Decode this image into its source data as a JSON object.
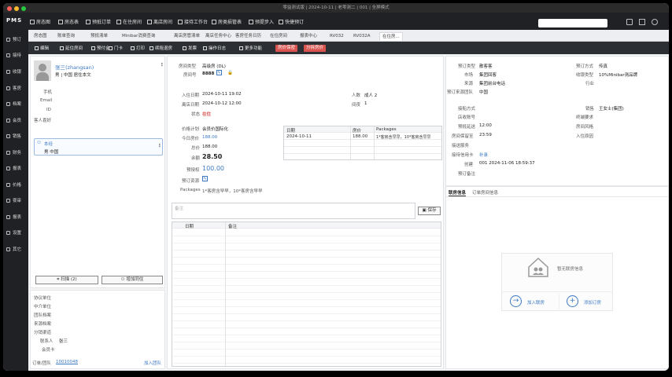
{
  "window": {
    "title": "零益测试版 | 2024-10-11 | 老零测二 | 001 | 全屏模式"
  },
  "logo": "PMS",
  "topnav": [
    "房态图",
    "房态表",
    "预抵订单",
    "在住房间",
    "离店房间",
    "接待工作台",
    "房类损管表",
    "预提步入",
    "快捷预订"
  ],
  "sidebar": [
    "预订",
    "接待",
    "收银",
    "客房",
    "档案",
    "会员",
    "销售",
    "财务",
    "报表",
    "价格",
    "夜审",
    "报表",
    "设置",
    "其它"
  ],
  "tabs": [
    "房态图",
    "账单查询",
    "预抵清单",
    "Minibar消费查询",
    "离店房管清单",
    "离店任务中心",
    "客房任务日历",
    "在住房间",
    "报表中心",
    "RV032",
    "RV032A",
    "在住房..."
  ],
  "toolbar": {
    "items": [
      "编辑",
      "延住房间",
      "预付金",
      "门卡",
      "打印",
      "续租退房",
      "发票",
      "操作日志",
      "更多功能"
    ],
    "red1": "房价保密",
    "red2": "分拆房价"
  },
  "guest": {
    "name": "张三(zhangsan)",
    "line": "男 | 中国 居住本文",
    "labels": [
      "手机",
      "Email",
      "ID",
      "客人喜好"
    ],
    "sub_name": "本经",
    "sub_line": "男 中国",
    "scan": "扫描 (2)",
    "add": "增加同住"
  },
  "left_bottom": {
    "labels": [
      "协议单位",
      "中介单位",
      "团队档案",
      "来源档案",
      "分销渠道",
      "联系人",
      "会员卡",
      "订单/团队"
    ],
    "contact": "张三",
    "order_no": "10010048",
    "join_team": "加入团队"
  },
  "middle": {
    "room_type_label": "房间类型",
    "room_type": "高级房 (DL)",
    "room_no_label": "房间号",
    "room_no": "8888",
    "arrive_label": "入住日期",
    "arrive": "2024-10-11 19:02",
    "depart_label": "离店日期",
    "depart": "2024-10-12 12:00",
    "status_label": "状态",
    "status": "在住",
    "adults_label": "人数",
    "adults": "成人 2",
    "nights_label": "间夜",
    "nights": "1",
    "rate_plan_label": "价格计划",
    "rate_plan": "会员价国际化",
    "today_label": "今日房价",
    "today": "188.00",
    "total_label": "总价",
    "total": "188.00",
    "balance_label": "余额",
    "balance": "28.50",
    "prepay_label": "预授权",
    "prepay": "100.00",
    "res_label": "预订资源",
    "pkg_label": "Packages",
    "pkg": "1*客房含早早，10*客房含早早",
    "note_ph": "备注",
    "save": "保存"
  },
  "rate_table": {
    "headers": [
      "日期",
      "房价",
      "Packages"
    ],
    "rows": [
      [
        "2024-10-11",
        "188.00",
        "1*客房含早早，10*客房含早早"
      ]
    ]
  },
  "log_table": {
    "headers": [
      "日期",
      "备注"
    ]
  },
  "right": {
    "l": [
      [
        "预订类型",
        "散客客"
      ],
      [
        "市场",
        "集团回客"
      ],
      [
        "来源",
        "集团前台电话"
      ],
      [
        "预订来源团队",
        "中国"
      ]
    ],
    "r": [
      [
        "预订方式",
        "传真"
      ],
      [
        "收银类型",
        "10%Minibar测品牌"
      ],
      [
        "行业",
        ""
      ]
    ],
    "l2": [
      [
        "接船方式",
        ""
      ],
      [
        "店收账号",
        ""
      ],
      [
        "预抵延送",
        "12:00"
      ],
      [
        "房间保留至",
        "23:59"
      ],
      [
        "接送服务",
        ""
      ],
      [
        "接待信用卡",
        "补录"
      ],
      [
        "创建",
        "001  2024-11-06 18:59:37"
      ],
      [
        "预订备注",
        ""
      ]
    ],
    "r2": [
      [
        "销售",
        "王女士(集团)"
      ],
      [
        "终端要求",
        ""
      ],
      [
        "房间风格",
        ""
      ],
      [
        "入住原因",
        ""
      ]
    ],
    "tab1": "联房信息",
    "tab2": "订单房间信息",
    "empty": "暂无联房信息",
    "join": "加入联房",
    "add": "添加订房"
  }
}
